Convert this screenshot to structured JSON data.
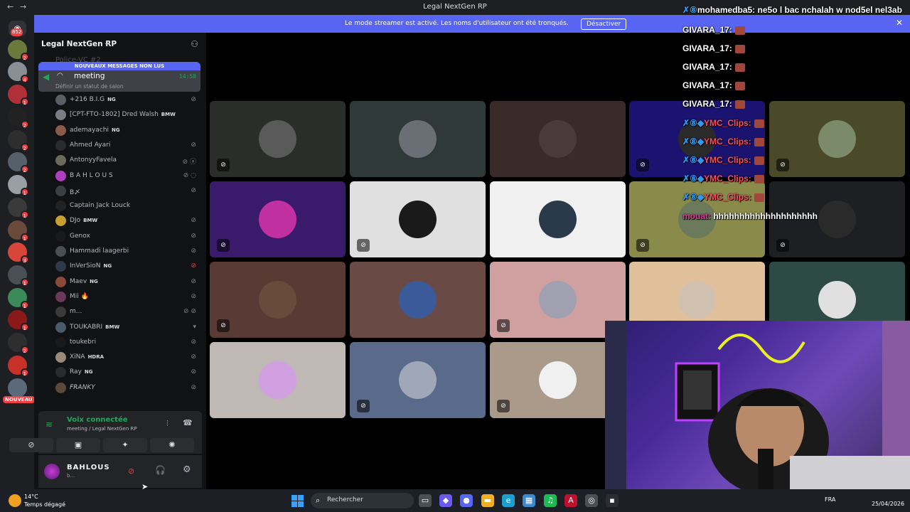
{
  "window": {
    "title": "Legal NextGen RP",
    "back_glyph": "←",
    "forward_glyph": "→"
  },
  "banner": {
    "text": "Le mode streamer est activé. Les noms d'utilisateur ont été tronqués.",
    "button": "Désactiver",
    "close": "✕"
  },
  "servers": {
    "home_badge": "852",
    "new_label": "NOUVEAU",
    "items": [
      {
        "badge": "2",
        "color": "#6b7a3a"
      },
      {
        "badge": "4",
        "color": "#8a8f96"
      },
      {
        "badge": "1",
        "color": "#b0303a"
      },
      {
        "badge": "2",
        "color": "#222222"
      },
      {
        "badge": "2",
        "color": "#2e2e2e"
      },
      {
        "badge": "2",
        "color": "#55606a"
      },
      {
        "badge": "1",
        "color": "#9a9fa6"
      },
      {
        "badge": "1",
        "color": "#3a3a3a"
      },
      {
        "badge": "1",
        "color": "#6a4a3a"
      },
      {
        "badge": "3",
        "color": "#d8463a"
      },
      {
        "badge": "1",
        "color": "#4a4f56"
      },
      {
        "badge": "1",
        "color": "#3a8a5a"
      },
      {
        "badge": "1",
        "color": "#8a1a1a"
      },
      {
        "badge": "2",
        "color": "#2e2e2e"
      },
      {
        "badge": "1",
        "color": "#c8302a"
      },
      {
        "badge": "",
        "color": "#5a6a7a"
      }
    ]
  },
  "guild": {
    "name": "Legal NextGen RP",
    "chevron": "⌄",
    "invite_icon": "add-friend-icon",
    "hidden_channel": "Police-VC #2",
    "unread_label": "NOUVEAUX MESSAGES NON LUS",
    "channel": {
      "name": "meeting",
      "time": "14:58",
      "status": "Définir un statut de salon"
    }
  },
  "members": [
    {
      "name": "+216 B.I.G",
      "tag": "NG",
      "mute": "⊘",
      "red": false,
      "color": "#5a5f66"
    },
    {
      "name": "[CPT-FTO-1802] Dred Walsh",
      "tag": "BMW",
      "mute": "",
      "red": false,
      "color": "#7a7f86"
    },
    {
      "name": "ademayachi",
      "tag": "NG",
      "mute": "",
      "red": false,
      "color": "#8a5a4a"
    },
    {
      "name": "Ahmed Ayari",
      "tag": "",
      "mute": "⊘",
      "red": false,
      "color": "#2a2a2a"
    },
    {
      "name": "AntonyyFavela",
      "tag": "",
      "mute": "⊘ ⓐ",
      "red": false,
      "color": "#6a6a5a"
    },
    {
      "name": "B A H L O U S",
      "tag": "",
      "mute": "⊘ ◌",
      "red": false,
      "color": "#b03fc0"
    },
    {
      "name": "B〆",
      "tag": "",
      "mute": "⊘",
      "red": false,
      "color": "#3a3f46"
    },
    {
      "name": "Captain Jack Louck",
      "tag": "",
      "mute": "",
      "red": false,
      "color": "#222222"
    },
    {
      "name": "DJo",
      "tag": "BMW",
      "mute": "⊘",
      "red": false,
      "color": "#c8a030"
    },
    {
      "name": "Genox",
      "tag": "",
      "mute": "⊘",
      "red": false,
      "color": "#1a1a1a"
    },
    {
      "name": "Hammadi laagerbi",
      "tag": "",
      "mute": "⊘",
      "red": false,
      "color": "#4a4f56"
    },
    {
      "name": "InVerSioN",
      "tag": "NG",
      "mute": "⊘",
      "red": true,
      "color": "#2e3a4a"
    },
    {
      "name": "Maev",
      "tag": "NG",
      "mute": "⊘",
      "red": false,
      "color": "#8a4a3a"
    },
    {
      "name": "Mii 🔥",
      "tag": "",
      "mute": "⊘",
      "red": false,
      "color": "#6a3a5a"
    },
    {
      "name": "m...",
      "tag": "",
      "mute": "⊘ ⊘",
      "red": false,
      "color": "#3a3a3a"
    },
    {
      "name": "TOUKABRI",
      "tag": "BMW",
      "mute": "▾",
      "red": false,
      "color": "#4a5a6a"
    },
    {
      "name": "toukebri",
      "tag": "",
      "mute": "⊘",
      "red": false,
      "color": "#1a1a1a"
    },
    {
      "name": "XiNA",
      "tag": "HDRA",
      "mute": "⊘",
      "red": false,
      "color": "#9a8a7a"
    },
    {
      "name": "Ray",
      "tag": "NG",
      "mute": "⊘",
      "red": false,
      "color": "#2a2a2a"
    },
    {
      "name": "𝘍𝘙𝘈𝘕𝘒𝘠",
      "tag": "",
      "mute": "⊘",
      "red": false,
      "color": "#5a4a3a"
    }
  ],
  "voice_panel": {
    "status": "Voix connectée",
    "location": "meeting / Legal NextGen RP",
    "actions": [
      "camera-off-icon",
      "screen-share-icon",
      "activities-icon",
      "soundboard-icon"
    ]
  },
  "user": {
    "name": "BAHLOUS",
    "sub": "b...",
    "mute_glyph": "⊘",
    "headset_glyph": "🎧",
    "gear_glyph": "⚙"
  },
  "tiles": [
    {
      "bg": "#2a2d29",
      "ava": "#5a5a5a",
      "mic": "⊘"
    },
    {
      "bg": "#2f3a38",
      "ava": "#6a6f76",
      "mic": ""
    },
    {
      "bg": "#3a2a2a",
      "ava": "#4a3a3a",
      "mic": ""
    },
    {
      "bg": "#1a1470",
      "ava": "#2a2a2a",
      "mic": "⊘"
    },
    {
      "bg": "#4a4a2a",
      "ava": "#7a8a6a",
      "mic": "⊘"
    },
    {
      "bg": "#3a1a6a",
      "ava": "#c030a0",
      "mic": "⊘"
    },
    {
      "bg": "#e0e0e0",
      "ava": "#1a1a1a",
      "mic": "⊘"
    },
    {
      "bg": "#f0f0f0",
      "ava": "#2a3a4a",
      "mic": ""
    },
    {
      "bg": "#8a8a4a",
      "ava": "#6a7a5a",
      "mic": "⊘"
    },
    {
      "bg": "#1e1f22",
      "ava": "#2a2a2a",
      "mic": "⊘"
    },
    {
      "bg": "#5a3a34",
      "ava": "#6a4a3a",
      "mic": "⊘"
    },
    {
      "bg": "#6a4a44",
      "ava": "#3a5a9a",
      "mic": ""
    },
    {
      "bg": "#d0a0a0",
      "ava": "#a0a0b0",
      "mic": "⊘"
    },
    {
      "bg": "#e0c09a",
      "ava": "#d0c0b0",
      "mic": ""
    },
    {
      "bg": "#2e4a44",
      "ava": "#e0e0e0",
      "mic": ""
    },
    {
      "bg": "#c0b8b4",
      "ava": "#d0a0e0",
      "mic": ""
    },
    {
      "bg": "#5a6a8a",
      "ava": "#a0a8b8",
      "mic": "⊘"
    },
    {
      "bg": "#aa9a8a",
      "ava": "#f0f0f0",
      "mic": "⊘"
    }
  ],
  "chat": [
    {
      "user": "mohamedba5:",
      "message": "ne5o l bac nchalah w nod5el nel3ab",
      "style": "white",
      "icons": "✗⑧",
      "emote": false
    },
    {
      "user": "GIVARA_17:",
      "message": "",
      "style": "white",
      "icons": "",
      "emote": true
    },
    {
      "user": "GIVARA_17:",
      "message": "",
      "style": "white",
      "icons": "",
      "emote": true
    },
    {
      "user": "GIVARA_17:",
      "message": "",
      "style": "white",
      "icons": "",
      "emote": true
    },
    {
      "user": "GIVARA_17:",
      "message": "",
      "style": "white",
      "icons": "",
      "emote": true
    },
    {
      "user": "GIVARA_17:",
      "message": "",
      "style": "white",
      "icons": "",
      "emote": true
    },
    {
      "user": "YMC_Clips:",
      "message": "",
      "style": "red",
      "icons": "✗⑧◆",
      "emote": true
    },
    {
      "user": "YMC_Clips:",
      "message": "",
      "style": "red",
      "icons": "✗⑧◆",
      "emote": true
    },
    {
      "user": "YMC_Clips:",
      "message": "",
      "style": "red",
      "icons": "✗⑧◆",
      "emote": true
    },
    {
      "user": "YMC_Clips:",
      "message": "",
      "style": "red",
      "icons": "✗⑧◆",
      "emote": true
    },
    {
      "user": "YMC_Clips:",
      "message": "",
      "style": "red",
      "icons": "✗⑧◆",
      "emote": true
    },
    {
      "user": "mouat:",
      "message": "hhhhhhhhhhhhhhhhhhhh",
      "style": "pink",
      "icons": "",
      "emote": false
    }
  ],
  "taskbar": {
    "temp": "14°C",
    "condition": "Temps dégagé",
    "search_label": "Rechercher",
    "lang": "FRA",
    "date": "25/04/2026",
    "apps": [
      {
        "glyph": "▭",
        "color": "#4a4f56"
      },
      {
        "glyph": "◆",
        "color": "#6a5af0"
      },
      {
        "glyph": "●",
        "color": "#5865f2"
      },
      {
        "glyph": "▬",
        "color": "#f0b020"
      },
      {
        "glyph": "e",
        "color": "#1aa0d0"
      },
      {
        "glyph": "▦",
        "color": "#3a8ad0"
      },
      {
        "glyph": "♫",
        "color": "#1db954"
      },
      {
        "glyph": "A",
        "color": "#c01030"
      },
      {
        "glyph": "◎",
        "color": "#4a4f56"
      },
      {
        "glyph": "▪",
        "color": "#2a2d34"
      }
    ]
  }
}
